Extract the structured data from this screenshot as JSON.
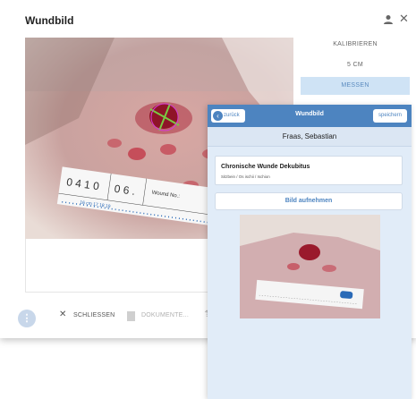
{
  "dialog": {
    "title": "Wundbild",
    "side_buttons": {
      "calibrate": "KALIBRIEREN",
      "scale": "5 CM",
      "measure": "MESSEN"
    },
    "bottom_bar": {
      "fab_icon": "more-vertical-icon",
      "close_label": "SCHLIESSEN",
      "documents_label": "DOKUMENTE..."
    },
    "ruler_text": {
      "left": "0 4 1 0",
      "mid": "0 6 .",
      "right": "Wound No.:",
      "scale": "16 cm  17  18 19"
    }
  },
  "phone": {
    "back_label": "zurück",
    "title": "Wundbild",
    "save_label": "speichern",
    "patient_name": "Fraas, Sebastian",
    "wound_title": "Chronische Wunde Dekubitus",
    "wound_location": "Sitzbein / Os ischii / Ischion",
    "capture_label": "Bild aufnehmen"
  },
  "colors": {
    "accent": "#4d84c0",
    "phone_background": "#e1ecf8",
    "measure_button": "#cfe3f5",
    "wound_red": "#a3162f",
    "measure_line": "#7ac943"
  }
}
